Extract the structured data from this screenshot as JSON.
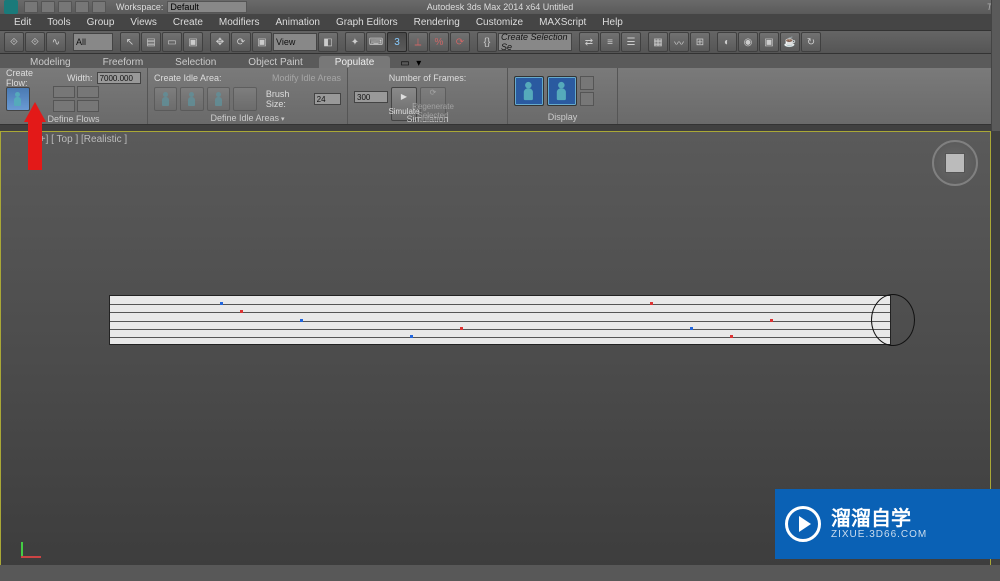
{
  "titlebar": {
    "workspace_label": "Workspace:",
    "workspace_value": "Default",
    "title": "Autodesk 3ds Max  2014 x64   Untitled",
    "search_placeholder": "Ty"
  },
  "menu": {
    "items": [
      "Edit",
      "Tools",
      "Group",
      "Views",
      "Create",
      "Modifiers",
      "Animation",
      "Graph Editors",
      "Rendering",
      "Customize",
      "MAXScript",
      "Help"
    ]
  },
  "toolbar": {
    "filter_all": "All",
    "view_drop": "View",
    "selset": "Create Selection Se"
  },
  "ribbon_tabs": [
    "Modeling",
    "Freeform",
    "Selection",
    "Object Paint",
    "Populate"
  ],
  "ribbon_active": "Populate",
  "populate": {
    "create_flow": "Create Flow:",
    "width_label": "Width:",
    "width_value": "7000.000",
    "define_flows": "Define Flows",
    "create_idle": "Create Idle Area:",
    "modify_idle": "Modify Idle Areas",
    "brush_size": "Brush Size:",
    "brush_value": "24",
    "define_idle": "Define Idle Areas",
    "num_frames": "Number of Frames:",
    "frames_value": "300",
    "simulate": "Simulate",
    "regenerate": "Regenerate Selected",
    "simulation": "Simulation",
    "display": "Display"
  },
  "viewport": {
    "label": "[+] [ Top ] [Realistic ]"
  },
  "watermark": {
    "text": "溜溜自学",
    "sub": "ZIXUE.3D66.COM"
  }
}
